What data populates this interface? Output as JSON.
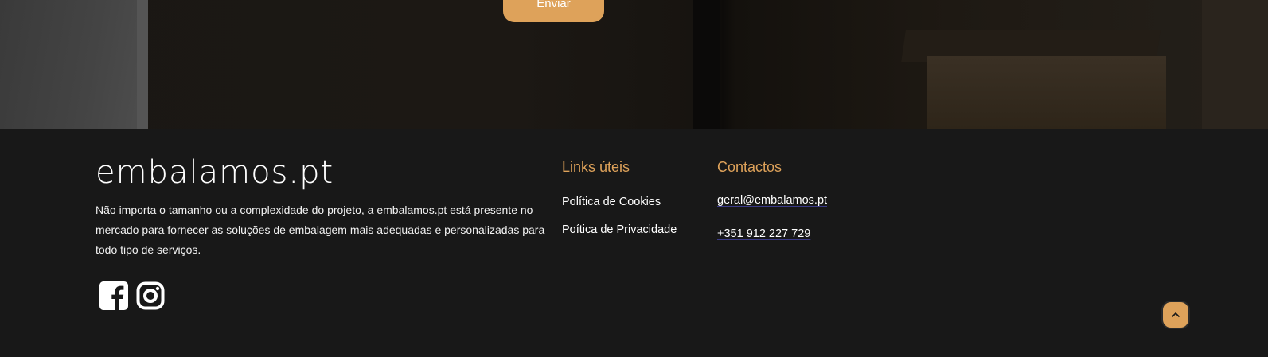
{
  "hero": {
    "send_label": "Enviar"
  },
  "footer": {
    "logo": "embalamos.pt",
    "description": "Não importa o tamanho ou a complexidade do projeto, a embalamos.pt está presente no mercado para fornecer as soluções de embalagem mais adequadas e personalizadas para todo tipo de serviços.",
    "social": [
      {
        "icon": "facebook-icon"
      },
      {
        "icon": "instagram-icon"
      }
    ],
    "links": {
      "title": "Links úteis",
      "items": [
        "Política de Cookies",
        "Poítica de Privacidade"
      ]
    },
    "contacts": {
      "title": "Contactos",
      "email": "geral@embalamos.pt",
      "phone": "+351 912 227 729"
    },
    "back_to_top_icon": "chevron-up-icon"
  },
  "colors": {
    "accent": "#dea25a",
    "background": "#181818",
    "text": "#ffffff"
  }
}
